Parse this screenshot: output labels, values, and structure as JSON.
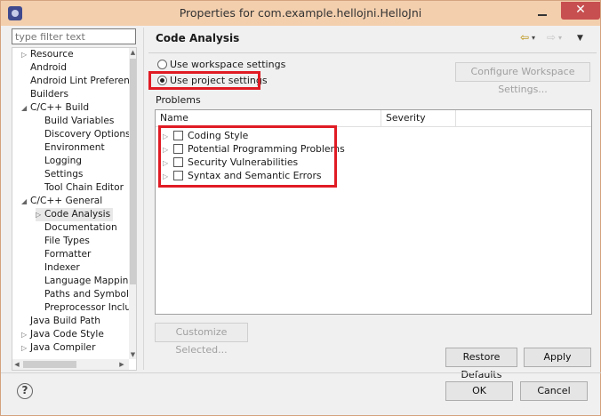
{
  "window": {
    "title": "Properties for com.example.hellojni.HelloJni",
    "close_glyph": "✕"
  },
  "filter": {
    "placeholder": "type filter text"
  },
  "tree": {
    "items": [
      {
        "label": "Resource",
        "expander": "▷"
      },
      {
        "label": "Android",
        "expander": ""
      },
      {
        "label": "Android Lint Preferences",
        "expander": ""
      },
      {
        "label": "Builders",
        "expander": ""
      },
      {
        "label": "C/C++ Build",
        "expander": "◢"
      },
      {
        "label": "Build Variables",
        "expander": ""
      },
      {
        "label": "Discovery Options",
        "expander": ""
      },
      {
        "label": "Environment",
        "expander": ""
      },
      {
        "label": "Logging",
        "expander": ""
      },
      {
        "label": "Settings",
        "expander": ""
      },
      {
        "label": "Tool Chain Editor",
        "expander": ""
      },
      {
        "label": "C/C++ General",
        "expander": "◢"
      },
      {
        "label": "Code Analysis",
        "expander": "▷"
      },
      {
        "label": "Documentation",
        "expander": ""
      },
      {
        "label": "File Types",
        "expander": ""
      },
      {
        "label": "Formatter",
        "expander": ""
      },
      {
        "label": "Indexer",
        "expander": ""
      },
      {
        "label": "Language Mappings",
        "expander": ""
      },
      {
        "label": "Paths and Symbols",
        "expander": ""
      },
      {
        "label": "Preprocessor Include Paths",
        "expander": ""
      },
      {
        "label": "Java Build Path",
        "expander": ""
      },
      {
        "label": "Java Code Style",
        "expander": "▷"
      },
      {
        "label": "Java Compiler",
        "expander": "▷"
      }
    ],
    "selected": "Code Analysis"
  },
  "page": {
    "title": "Code Analysis",
    "nav": {
      "back_glyph": "⇦",
      "back_menu_glyph": "▾",
      "forward_glyph": "⇨",
      "forward_menu_glyph": "▾",
      "view_menu_glyph": "▼"
    },
    "radio_workspace": "Use workspace settings",
    "radio_project": "Use project settings",
    "configure_workspace_button": "Configure Workspace Settings...",
    "problems_label": "Problems",
    "columns": [
      "Name",
      "Severity"
    ],
    "problems": [
      {
        "label": "Coding Style",
        "checked": false
      },
      {
        "label": "Potential Programming Problems",
        "checked": false
      },
      {
        "label": "Security Vulnerabilities",
        "checked": false
      },
      {
        "label": "Syntax and Semantic Errors",
        "checked": false
      }
    ],
    "expander_glyph": "▷",
    "customize_button": "Customize Selected...",
    "restore_defaults_button": "Restore Defaults",
    "apply_button": "Apply"
  },
  "footer": {
    "help_glyph": "?",
    "ok_button": "OK",
    "cancel_button": "Cancel"
  },
  "colors": {
    "highlight": "#e01b24",
    "titlebar": "#f3cfae",
    "close": "#c74f4f"
  }
}
